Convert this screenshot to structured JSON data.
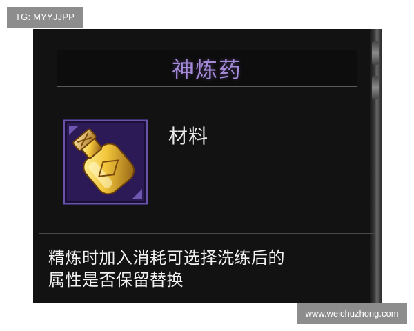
{
  "watermarks": {
    "top_left": "TG: MYYJJPP",
    "bottom_right": "www.weichuzhong.com"
  },
  "tooltip": {
    "title": "神炼药",
    "item_type": "材料",
    "icon": "elixir-bottle-icon",
    "description_lines": [
      "精炼时加入消耗可选择洗练后的",
      "属性是否保留替换"
    ]
  },
  "colors": {
    "title": "#a58ad8",
    "icon_border": "#6a52a8",
    "icon_background": "#2b1a55",
    "tooltip_background": "#121212"
  }
}
